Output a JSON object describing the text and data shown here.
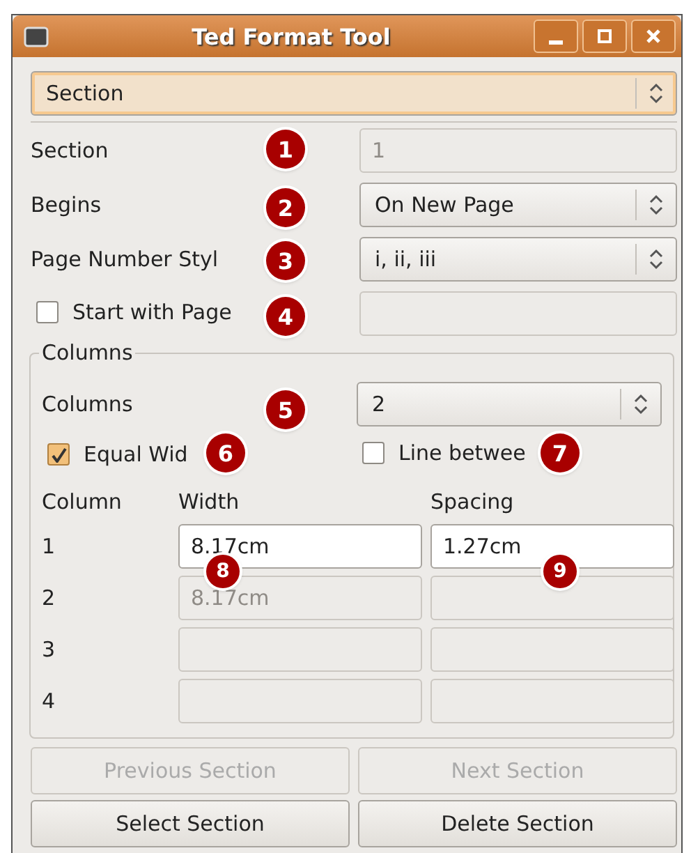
{
  "window": {
    "title": "Ted Format Tool"
  },
  "section_selector": {
    "value": "Section"
  },
  "form_rows": [
    {
      "kind": "text",
      "label": "Section",
      "value": "1",
      "disabled": true
    },
    {
      "kind": "select",
      "label": "Begins",
      "value": "On New Page",
      "disabled": false
    },
    {
      "kind": "select",
      "label": "Page Number Styl",
      "value": "i, ii, iii",
      "disabled": false
    },
    {
      "kind": "check",
      "label": "Start with Page",
      "checked": false,
      "value_disabled": true
    }
  ],
  "columns_group": {
    "title": "Columns",
    "count_label": "Columns",
    "count_value": "2",
    "equal_width": {
      "label": "Equal Wid",
      "checked": true
    },
    "line_between": {
      "label": "Line betwee",
      "checked": false
    },
    "headers": [
      "Column",
      "Width",
      "Spacing"
    ],
    "rows": [
      {
        "number": "1",
        "width": "8.17cm",
        "width_disabled": false,
        "spacing": "1.27cm",
        "spacing_disabled": false
      },
      {
        "number": "2",
        "width": "8.17cm",
        "width_disabled": true,
        "spacing_disabled": true
      },
      {
        "number": "3",
        "width_disabled": true,
        "spacing_disabled": true
      },
      {
        "number": "4",
        "width_disabled": true,
        "spacing_disabled": true
      }
    ]
  },
  "buttons": [
    {
      "label": "Previous Section",
      "disabled": true
    },
    {
      "label": "Next Section",
      "disabled": true
    },
    {
      "label": "Select Section",
      "disabled": false
    },
    {
      "label": "Delete Section",
      "disabled": false
    }
  ],
  "callouts": [
    "1",
    "2",
    "3",
    "4",
    "5",
    "6",
    "7",
    "8",
    "9"
  ]
}
